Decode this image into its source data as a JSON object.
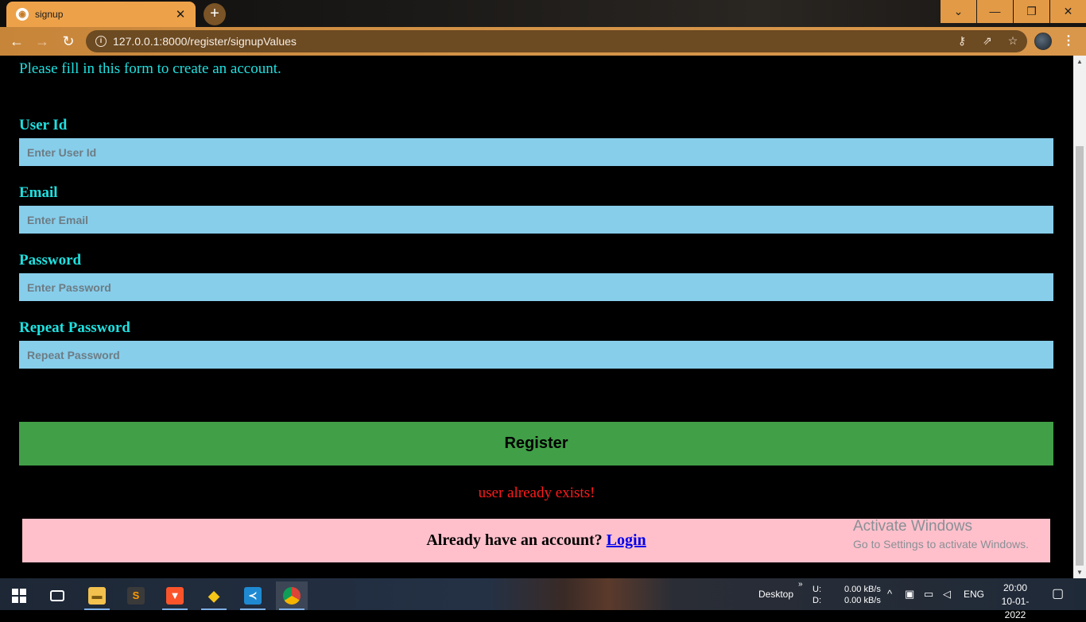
{
  "browser": {
    "tab_title": "signup",
    "tab_close": "✕",
    "new_tab": "+",
    "url": "127.0.0.1:8000/register/signupValues",
    "window_controls": {
      "dropdown": "⌄",
      "minimize": "—",
      "restore": "❐",
      "close": "✕"
    },
    "nav": {
      "back": "←",
      "forward": "→",
      "reload": "↻"
    },
    "omnibox_icons": [
      "key-icon",
      "share-icon",
      "star-icon"
    ],
    "accent_color": "#eda24a"
  },
  "form": {
    "intro": "Please fill in this form to create an account.",
    "fields": [
      {
        "label": "User Id",
        "placeholder": "Enter User Id",
        "value": ""
      },
      {
        "label": "Email",
        "placeholder": "Enter Email",
        "value": ""
      },
      {
        "label": "Password",
        "placeholder": "Enter Password",
        "value": ""
      },
      {
        "label": "Repeat Password",
        "placeholder": "Repeat Password",
        "value": ""
      }
    ],
    "register_label": "Register",
    "error_message": "user already exists!",
    "signin_text": "Already have an account?",
    "signin_link": "Login",
    "colors": {
      "label": "#1fe0e0",
      "input_bg": "#87ceeb",
      "button_bg": "#419f47",
      "error": "#ff1a1a",
      "signin_bg": "#ffc0cb"
    }
  },
  "watermark": {
    "line1": "Activate Windows",
    "line2": "Go to Settings to activate Windows."
  },
  "taskbar": {
    "apps": [
      "windows-start",
      "task-view",
      "file-explorer",
      "sublime-text",
      "brave-browser",
      "git",
      "vs-code",
      "chrome"
    ],
    "desktop_label": "Desktop",
    "net_up_label": "U:",
    "net_down_label": "D:",
    "net_up": "0.00 kB/s",
    "net_down": "0.00 kB/s",
    "language": "ENG",
    "time": "20:00",
    "date": "10-01-2022"
  }
}
